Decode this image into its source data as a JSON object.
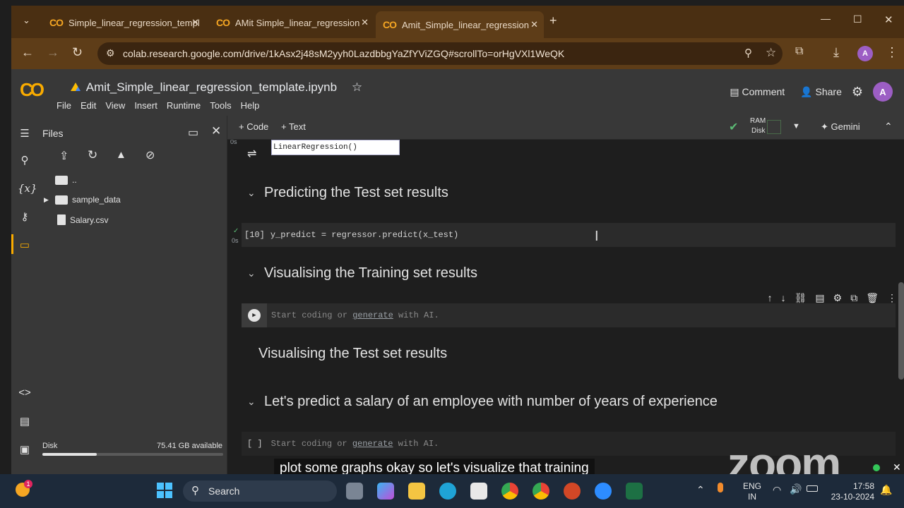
{
  "browser": {
    "tabs": [
      {
        "title": "Simple_linear_regression_templ",
        "active": false
      },
      {
        "title": "AMit Simple_linear_regression",
        "active": false
      },
      {
        "title": "Amit_Simple_linear_regression",
        "active": true
      }
    ],
    "url": "colab.research.google.com/drive/1kAsx2j48sM2yyh0LazdbbgYaZfYViZGQ#scrollTo=orHgVXl1WeQK",
    "profile_initial": "A"
  },
  "colab": {
    "logo_text": "CO",
    "notebook_title": "Amit_Simple_linear_regression_template.ipynb",
    "menu": [
      "File",
      "Edit",
      "View",
      "Insert",
      "Runtime",
      "Tools",
      "Help"
    ],
    "comment_label": "Comment",
    "share_label": "Share",
    "avatar_initial": "A",
    "toolbar": {
      "code_label": "+ Code",
      "text_label": "+ Text",
      "ram_label": "RAM",
      "disk_label": "Disk",
      "gemini_label": "Gemini"
    }
  },
  "files_pane": {
    "title": "Files",
    "tree": [
      {
        "name": "..",
        "type": "folder"
      },
      {
        "name": "sample_data",
        "type": "folder"
      },
      {
        "name": "Salary.csv",
        "type": "file"
      }
    ],
    "disk_label": "Disk",
    "disk_available": "75.41 GB available",
    "disk_used_fraction": 0.3
  },
  "notebook": {
    "output_exec_time": "0s",
    "output_text": "LinearRegression()",
    "sections": [
      {
        "title": "Predicting the Test set results"
      },
      {
        "title": "Visualising the Training set results"
      },
      {
        "title": "Visualising the Test set results"
      },
      {
        "title": "Let's predict a salary of an employee with number of years of experience"
      }
    ],
    "predict_cell": {
      "exec_count": "[10]",
      "code": "y_predict = regressor.predict(x_test)",
      "time": "0s"
    },
    "empty_cell": {
      "prefix": "Start coding or ",
      "link": "generate",
      "suffix": " with AI."
    },
    "empty_cell_bracket": "[ ]"
  },
  "overlay": {
    "subtitle": "plot some graphs okay so let's visualize that training",
    "zoom_watermark": "zoom"
  },
  "taskbar": {
    "search_placeholder": "Search",
    "lang": "ENG",
    "region": "IN",
    "time": "17:58",
    "date": "23-10-2024",
    "notification_badge": "1"
  },
  "colors": {
    "accent_orange": "#f9ab00",
    "check_green": "#5bb974",
    "avatar_purple": "#9c5ec4"
  }
}
